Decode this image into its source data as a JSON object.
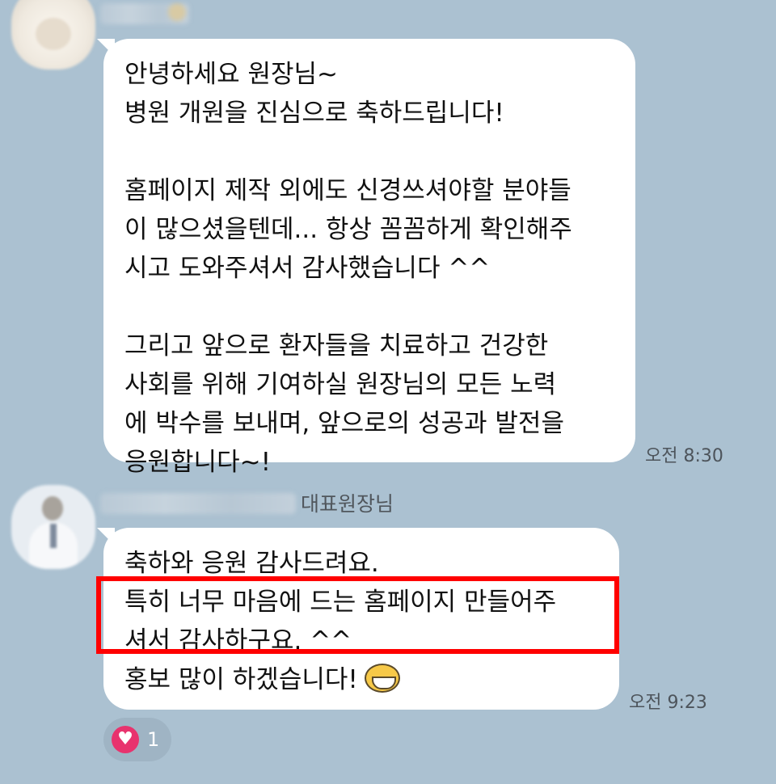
{
  "messages": [
    {
      "lines": [
        "안녕하세요 원장님~",
        "병원 개원을 진심으로 축하드립니다!",
        "",
        "홈페이지 제작 외에도 신경쓰셔야할 분야들",
        "이 많으셨을텐데... 항상 꼼꼼하게 확인해주",
        "시고 도와주셔서 감사했습니다 ^^",
        "",
        "그리고 앞으로 환자들을 치료하고 건강한",
        "사회를 위해 기여하실 원장님의 모든 노력",
        "에 박수를 보내며, 앞으로의 성공과 발전을",
        "응원합니다~!"
      ],
      "time": "오전 8:30"
    },
    {
      "role": "대표원장님",
      "lines": [
        "축하와 응원 감사드려요.",
        "특히 너무 마음에 드는 홈페이지 만들어주",
        "셔서 감사하구요. ^^",
        "홍보 많이 하겠습니다!"
      ],
      "emoji": "grinning-emoticon",
      "time": "오전 9:23",
      "reaction": {
        "icon": "heart-icon",
        "count": "1",
        "color": "#e8336e"
      }
    }
  ],
  "highlight_color": "#ff0000",
  "background_color": "#abc1d1"
}
